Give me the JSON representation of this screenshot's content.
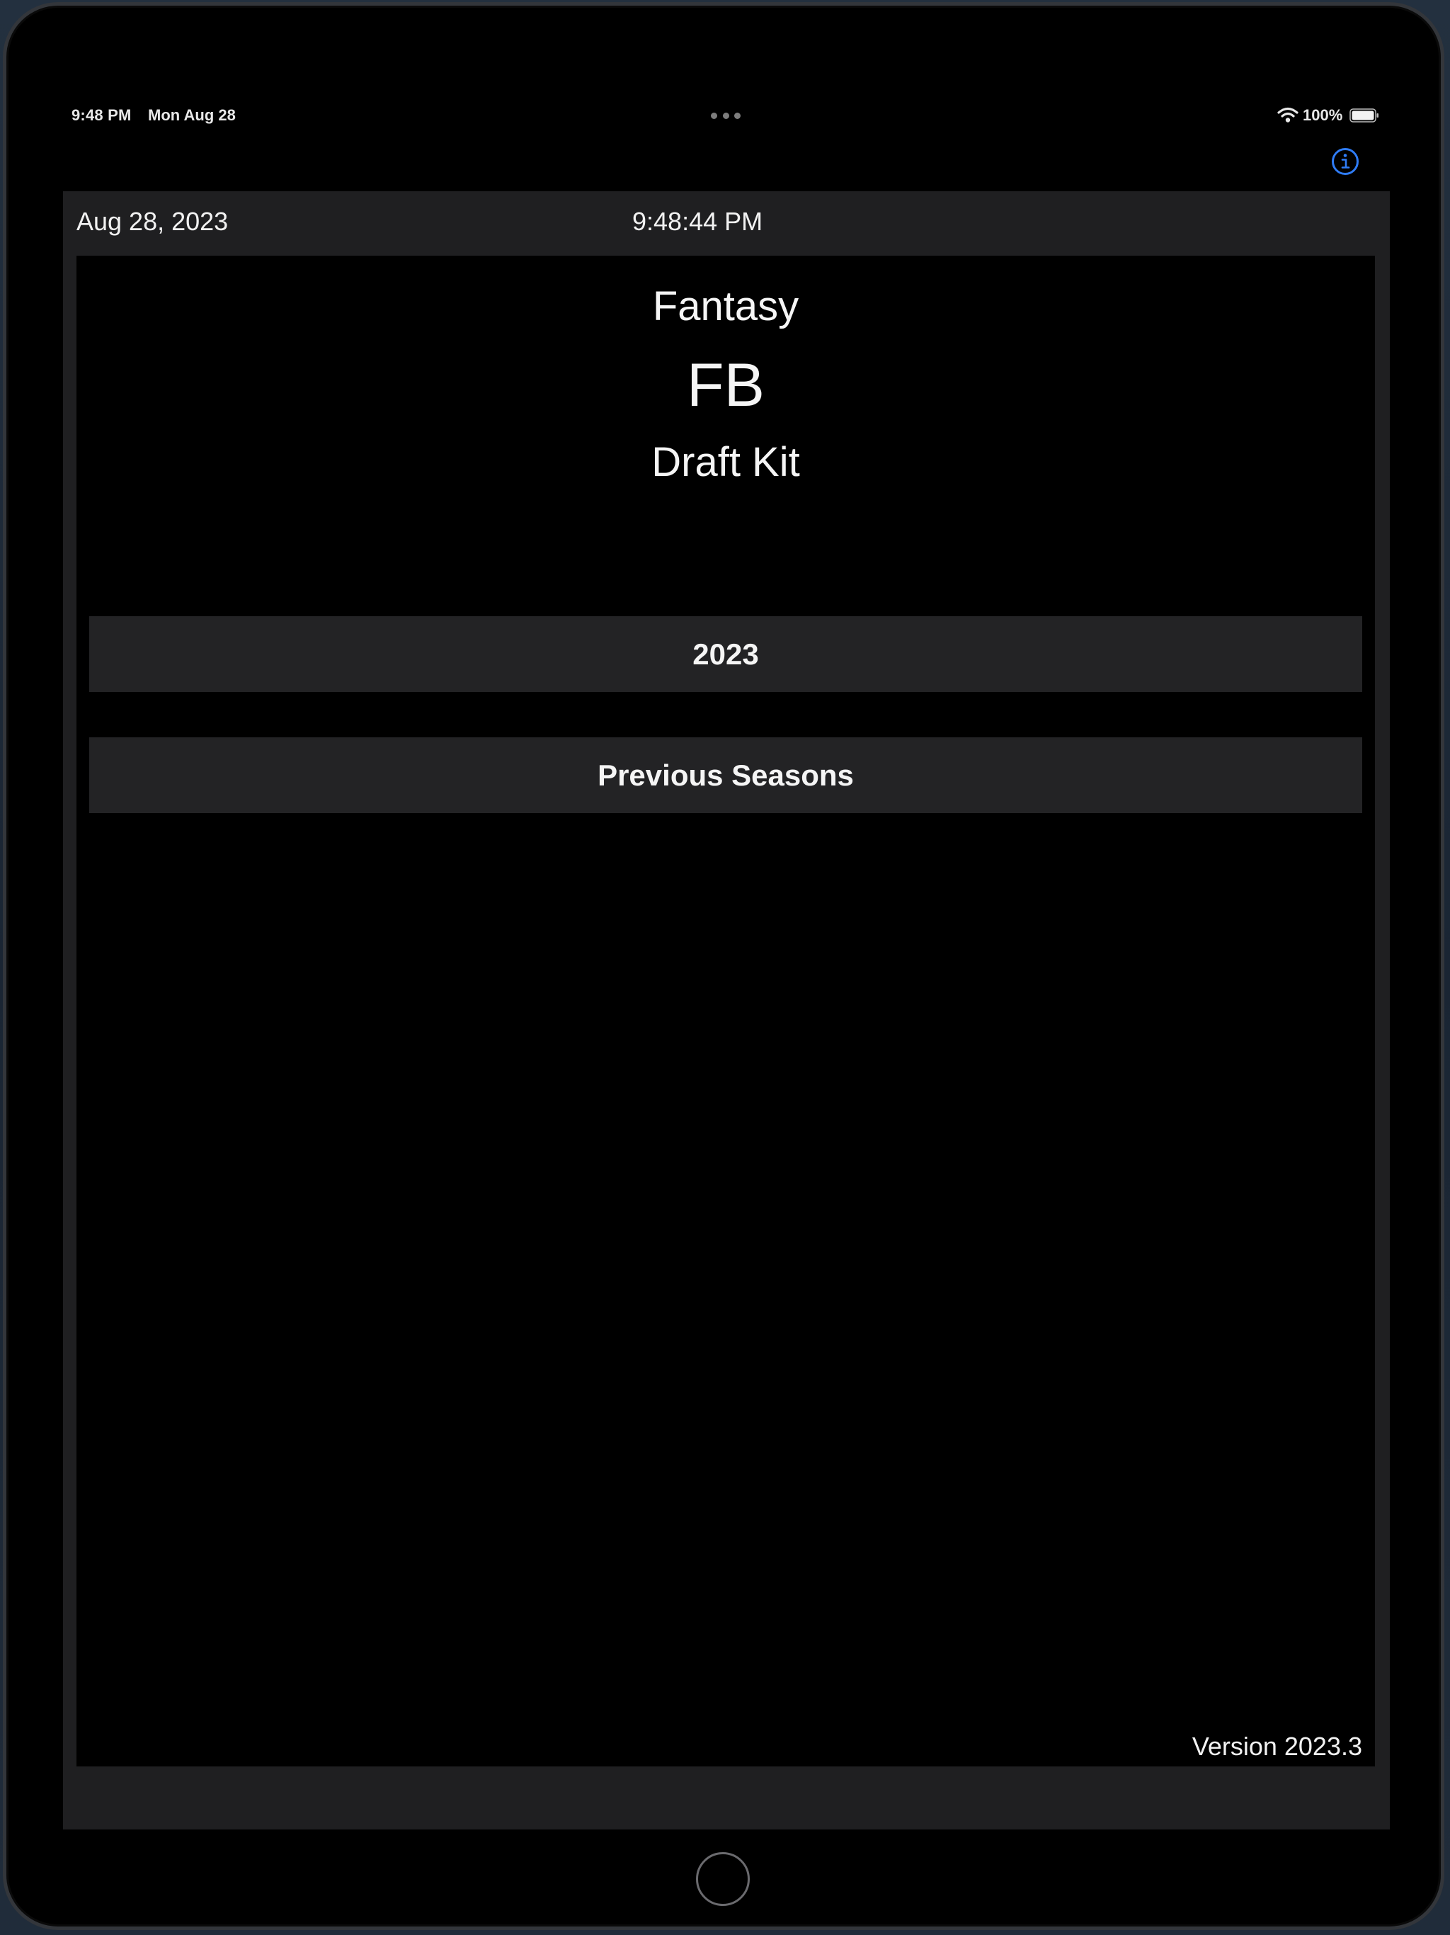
{
  "status_bar": {
    "time": "9:48 PM",
    "date": "Mon Aug 28",
    "battery_percent": "100%",
    "wifi_icon": "wifi-icon",
    "battery_icon": "battery-full-icon",
    "multitask_icon": "ellipsis-dots-icon"
  },
  "nav": {
    "info_icon": "info-circle-icon",
    "info_color": "#2f7cf6"
  },
  "header": {
    "date": "Aug 28, 2023",
    "time": "9:48:44 PM"
  },
  "title": {
    "line1": "Fantasy",
    "line2": "FB",
    "line3": "Draft Kit"
  },
  "menu": {
    "current_season": "2023",
    "previous_seasons": "Previous Seasons"
  },
  "footer": {
    "version": "Version 2023.3"
  },
  "colors": {
    "panel": "#1f1f21",
    "button": "#232325",
    "background": "#000000",
    "text": "#f5f5f5"
  }
}
